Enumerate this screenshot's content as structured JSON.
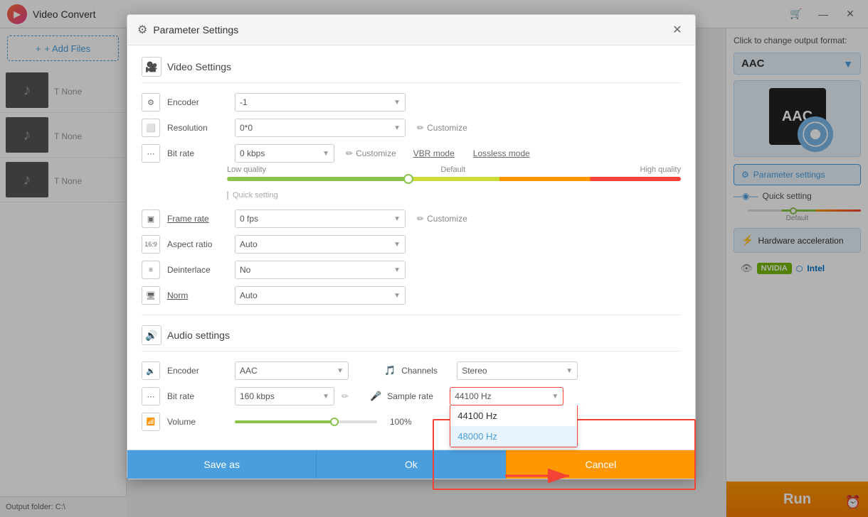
{
  "app": {
    "title": "Video Convert",
    "logo": "▶",
    "header_btns": [
      "🛒",
      "—",
      "✕"
    ]
  },
  "sidebar": {
    "add_files_label": "+ Add Files",
    "media_items": [
      {
        "format": "None",
        "has_thumb": true
      },
      {
        "format": "None",
        "has_thumb": true
      },
      {
        "format": "None",
        "has_thumb": true
      }
    ],
    "output_folder_label": "Output folder:",
    "output_folder_path": "C:\\"
  },
  "right_panel": {
    "change_format_label": "Click to change output format:",
    "format_label": "AAC",
    "aac_text": "AAC",
    "param_settings_label": "Parameter settings",
    "quick_setting_label": "Quick setting",
    "default_label": "Default",
    "hw_accel_label": "Hardware acceleration",
    "nvidia_label": "NVIDIA",
    "intel_chip_label": "intel",
    "intel_label": "Intel",
    "run_label": "Run"
  },
  "dialog": {
    "title": "Parameter Settings",
    "close_label": "✕",
    "video_section_title": "Video Settings",
    "audio_section_title": "Audio settings",
    "video_fields": {
      "encoder_label": "Encoder",
      "encoder_value": "-1",
      "resolution_label": "Resolution",
      "resolution_value": "0*0",
      "customize_label": "Customize",
      "bitrate_label": "Bit rate",
      "bitrate_value": "0 kbps",
      "vbr_mode_label": "VBR mode",
      "lossless_mode_label": "Lossless mode",
      "quick_setting_label": "Quick setting",
      "low_quality_label": "Low quality",
      "default_label": "Default",
      "high_quality_label": "High quality",
      "frame_rate_label": "Frame rate",
      "frame_rate_value": "0 fps",
      "aspect_ratio_label": "Aspect ratio",
      "aspect_ratio_value": "Auto",
      "deinterlace_label": "Deinterlace",
      "deinterlace_value": "No",
      "norm_label": "Norm",
      "norm_value": "Auto"
    },
    "audio_fields": {
      "encoder_label": "Encoder",
      "encoder_value": "AAC",
      "bitrate_label": "Bit rate",
      "bitrate_value": "160 kbps",
      "channels_label": "Channels",
      "channels_value": "Stereo",
      "sample_rate_label": "Sample rate",
      "sample_rate_value": "44100 Hz",
      "volume_label": "Volume",
      "volume_value": "100%",
      "sample_rate_options": [
        {
          "value": "44100 Hz",
          "label": "44100 Hz"
        },
        {
          "value": "48000 Hz",
          "label": "48000 Hz"
        }
      ]
    },
    "footer": {
      "save_as_label": "Save as",
      "ok_label": "Ok",
      "cancel_label": "Cancel"
    }
  }
}
